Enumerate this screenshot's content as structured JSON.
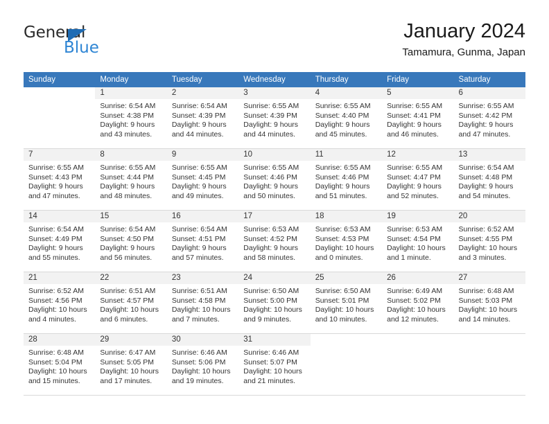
{
  "logo": {
    "word_top": "General",
    "word_bottom": "Blue",
    "color_dark": "#2b2b2b",
    "color_blue": "#2e85d4",
    "triangle_color": "#1f6cb4"
  },
  "header": {
    "title": "January 2024",
    "subtitle": "Tamamura, Gunma, Japan"
  },
  "theme": {
    "header_row_bg": "#3878bb",
    "header_row_text": "#ffffff",
    "daynum_band_bg": "#f2f2f2",
    "grid_line": "#d9d9d9",
    "body_text": "#333333"
  },
  "weekdays": [
    "Sunday",
    "Monday",
    "Tuesday",
    "Wednesday",
    "Thursday",
    "Friday",
    "Saturday"
  ],
  "weeks": [
    [
      {
        "day": "",
        "sunrise": "",
        "sunset": "",
        "daylight": "",
        "blank": true
      },
      {
        "day": "1",
        "sunrise": "Sunrise: 6:54 AM",
        "sunset": "Sunset: 4:38 PM",
        "daylight": "Daylight: 9 hours and 43 minutes."
      },
      {
        "day": "2",
        "sunrise": "Sunrise: 6:54 AM",
        "sunset": "Sunset: 4:39 PM",
        "daylight": "Daylight: 9 hours and 44 minutes."
      },
      {
        "day": "3",
        "sunrise": "Sunrise: 6:55 AM",
        "sunset": "Sunset: 4:39 PM",
        "daylight": "Daylight: 9 hours and 44 minutes."
      },
      {
        "day": "4",
        "sunrise": "Sunrise: 6:55 AM",
        "sunset": "Sunset: 4:40 PM",
        "daylight": "Daylight: 9 hours and 45 minutes."
      },
      {
        "day": "5",
        "sunrise": "Sunrise: 6:55 AM",
        "sunset": "Sunset: 4:41 PM",
        "daylight": "Daylight: 9 hours and 46 minutes."
      },
      {
        "day": "6",
        "sunrise": "Sunrise: 6:55 AM",
        "sunset": "Sunset: 4:42 PM",
        "daylight": "Daylight: 9 hours and 47 minutes."
      }
    ],
    [
      {
        "day": "7",
        "sunrise": "Sunrise: 6:55 AM",
        "sunset": "Sunset: 4:43 PM",
        "daylight": "Daylight: 9 hours and 47 minutes."
      },
      {
        "day": "8",
        "sunrise": "Sunrise: 6:55 AM",
        "sunset": "Sunset: 4:44 PM",
        "daylight": "Daylight: 9 hours and 48 minutes."
      },
      {
        "day": "9",
        "sunrise": "Sunrise: 6:55 AM",
        "sunset": "Sunset: 4:45 PM",
        "daylight": "Daylight: 9 hours and 49 minutes."
      },
      {
        "day": "10",
        "sunrise": "Sunrise: 6:55 AM",
        "sunset": "Sunset: 4:46 PM",
        "daylight": "Daylight: 9 hours and 50 minutes."
      },
      {
        "day": "11",
        "sunrise": "Sunrise: 6:55 AM",
        "sunset": "Sunset: 4:46 PM",
        "daylight": "Daylight: 9 hours and 51 minutes."
      },
      {
        "day": "12",
        "sunrise": "Sunrise: 6:55 AM",
        "sunset": "Sunset: 4:47 PM",
        "daylight": "Daylight: 9 hours and 52 minutes."
      },
      {
        "day": "13",
        "sunrise": "Sunrise: 6:54 AM",
        "sunset": "Sunset: 4:48 PM",
        "daylight": "Daylight: 9 hours and 54 minutes."
      }
    ],
    [
      {
        "day": "14",
        "sunrise": "Sunrise: 6:54 AM",
        "sunset": "Sunset: 4:49 PM",
        "daylight": "Daylight: 9 hours and 55 minutes."
      },
      {
        "day": "15",
        "sunrise": "Sunrise: 6:54 AM",
        "sunset": "Sunset: 4:50 PM",
        "daylight": "Daylight: 9 hours and 56 minutes."
      },
      {
        "day": "16",
        "sunrise": "Sunrise: 6:54 AM",
        "sunset": "Sunset: 4:51 PM",
        "daylight": "Daylight: 9 hours and 57 minutes."
      },
      {
        "day": "17",
        "sunrise": "Sunrise: 6:53 AM",
        "sunset": "Sunset: 4:52 PM",
        "daylight": "Daylight: 9 hours and 58 minutes."
      },
      {
        "day": "18",
        "sunrise": "Sunrise: 6:53 AM",
        "sunset": "Sunset: 4:53 PM",
        "daylight": "Daylight: 10 hours and 0 minutes."
      },
      {
        "day": "19",
        "sunrise": "Sunrise: 6:53 AM",
        "sunset": "Sunset: 4:54 PM",
        "daylight": "Daylight: 10 hours and 1 minute."
      },
      {
        "day": "20",
        "sunrise": "Sunrise: 6:52 AM",
        "sunset": "Sunset: 4:55 PM",
        "daylight": "Daylight: 10 hours and 3 minutes."
      }
    ],
    [
      {
        "day": "21",
        "sunrise": "Sunrise: 6:52 AM",
        "sunset": "Sunset: 4:56 PM",
        "daylight": "Daylight: 10 hours and 4 minutes."
      },
      {
        "day": "22",
        "sunrise": "Sunrise: 6:51 AM",
        "sunset": "Sunset: 4:57 PM",
        "daylight": "Daylight: 10 hours and 6 minutes."
      },
      {
        "day": "23",
        "sunrise": "Sunrise: 6:51 AM",
        "sunset": "Sunset: 4:58 PM",
        "daylight": "Daylight: 10 hours and 7 minutes."
      },
      {
        "day": "24",
        "sunrise": "Sunrise: 6:50 AM",
        "sunset": "Sunset: 5:00 PM",
        "daylight": "Daylight: 10 hours and 9 minutes."
      },
      {
        "day": "25",
        "sunrise": "Sunrise: 6:50 AM",
        "sunset": "Sunset: 5:01 PM",
        "daylight": "Daylight: 10 hours and 10 minutes."
      },
      {
        "day": "26",
        "sunrise": "Sunrise: 6:49 AM",
        "sunset": "Sunset: 5:02 PM",
        "daylight": "Daylight: 10 hours and 12 minutes."
      },
      {
        "day": "27",
        "sunrise": "Sunrise: 6:48 AM",
        "sunset": "Sunset: 5:03 PM",
        "daylight": "Daylight: 10 hours and 14 minutes."
      }
    ],
    [
      {
        "day": "28",
        "sunrise": "Sunrise: 6:48 AM",
        "sunset": "Sunset: 5:04 PM",
        "daylight": "Daylight: 10 hours and 15 minutes."
      },
      {
        "day": "29",
        "sunrise": "Sunrise: 6:47 AM",
        "sunset": "Sunset: 5:05 PM",
        "daylight": "Daylight: 10 hours and 17 minutes."
      },
      {
        "day": "30",
        "sunrise": "Sunrise: 6:46 AM",
        "sunset": "Sunset: 5:06 PM",
        "daylight": "Daylight: 10 hours and 19 minutes."
      },
      {
        "day": "31",
        "sunrise": "Sunrise: 6:46 AM",
        "sunset": "Sunset: 5:07 PM",
        "daylight": "Daylight: 10 hours and 21 minutes."
      },
      {
        "day": "",
        "sunrise": "",
        "sunset": "",
        "daylight": "",
        "blank": true
      },
      {
        "day": "",
        "sunrise": "",
        "sunset": "",
        "daylight": "",
        "blank": true
      },
      {
        "day": "",
        "sunrise": "",
        "sunset": "",
        "daylight": "",
        "blank": true
      }
    ]
  ]
}
